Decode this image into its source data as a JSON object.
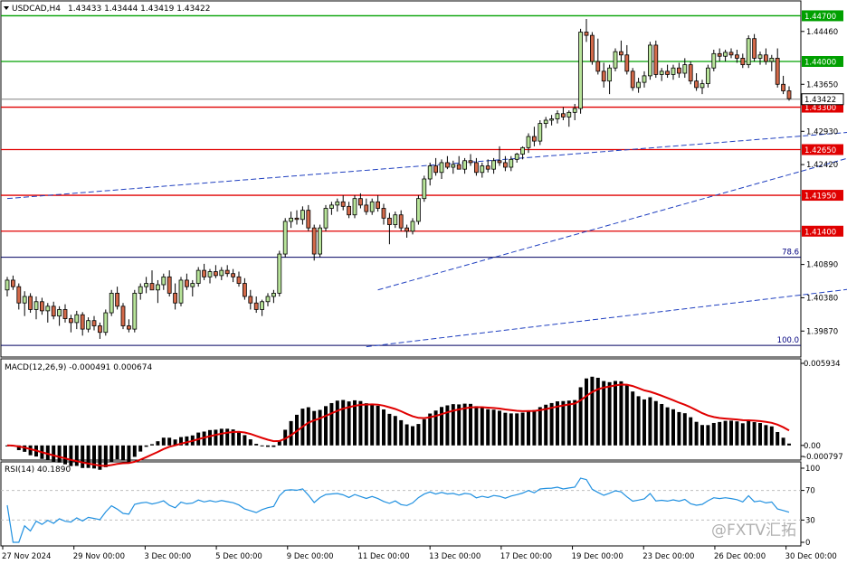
{
  "chart_data": {
    "type": "candlestick",
    "header": {
      "symbol": "USDCAD,H4",
      "ohlc": "1.43433 1.43444 1.43419 1.43422"
    },
    "price_axis": {
      "min": 1.395,
      "max": 1.449,
      "ticks": [
        "1.44460",
        "1.43650",
        "1.42930",
        "1.42420",
        "1.40890",
        "1.40380",
        "1.39870"
      ],
      "current_price": "1.43422",
      "current_value": 1.43422
    },
    "x_axis": {
      "labels": [
        "27 Nov 2024",
        "29 Nov 00:00",
        "3 Dec 00:00",
        "5 Dec 00:00",
        "9 Dec 00:00",
        "11 Dec 00:00",
        "13 Dec 00:00",
        "17 Dec 00:00",
        "19 Dec 00:00",
        "23 Dec 00:00",
        "26 Dec 00:00",
        "30 Dec 00:00"
      ]
    },
    "levels": [
      {
        "label": "1.44700",
        "value": 1.447,
        "color": "#00a000"
      },
      {
        "label": "1.44000",
        "value": 1.44,
        "color": "#00a000"
      },
      {
        "label": "1.43300",
        "value": 1.433,
        "color": "#e00000"
      },
      {
        "label": "1.42650",
        "value": 1.4265,
        "color": "#e00000"
      },
      {
        "label": "1.41950",
        "value": 1.4195,
        "color": "#e00000"
      },
      {
        "label": "1.41400",
        "value": 1.414,
        "color": "#e00000"
      }
    ],
    "fib_levels": [
      {
        "label": "78.6",
        "value": 1.41
      },
      {
        "label": "100.0",
        "value": 1.3965
      }
    ],
    "trendlines": [
      {
        "from": [
          0,
          1.419
        ],
        "to": [
          222,
          1.4345
        ]
      },
      {
        "from": [
          62,
          1.3963
        ],
        "to": [
          222,
          1.4132
        ]
      },
      {
        "from": [
          64,
          1.405
        ],
        "to": [
          222,
          1.4443
        ]
      }
    ],
    "candles": [
      [
        1.405,
        1.407,
        1.404,
        1.4065
      ],
      [
        1.4065,
        1.4072,
        1.405,
        1.4055
      ],
      [
        1.4055,
        1.406,
        1.402,
        1.403
      ],
      [
        1.403,
        1.4048,
        1.401,
        1.404
      ],
      [
        1.404,
        1.4045,
        1.4015,
        1.402
      ],
      [
        1.402,
        1.404,
        1.4005,
        1.4032
      ],
      [
        1.4032,
        1.4038,
        1.4012,
        1.4018
      ],
      [
        1.4018,
        1.403,
        1.4,
        1.4025
      ],
      [
        1.4025,
        1.4032,
        1.4005,
        1.401
      ],
      [
        1.401,
        1.4025,
        1.3995,
        1.402
      ],
      [
        1.402,
        1.4028,
        1.4,
        1.4006
      ],
      [
        1.4006,
        1.4012,
        1.3985,
        1.4
      ],
      [
        1.4,
        1.4018,
        1.399,
        1.4012
      ],
      [
        1.4012,
        1.4016,
        1.398,
        1.399
      ],
      [
        1.399,
        1.4008,
        1.3985,
        1.4003
      ],
      [
        1.4003,
        1.401,
        1.3988,
        1.3995
      ],
      [
        1.3995,
        1.4,
        1.3975,
        1.3985
      ],
      [
        1.3985,
        1.402,
        1.398,
        1.4015
      ],
      [
        1.4015,
        1.405,
        1.401,
        1.4045
      ],
      [
        1.4045,
        1.4055,
        1.402,
        1.4025
      ],
      [
        1.4025,
        1.403,
        1.399,
        1.3995
      ],
      [
        1.3995,
        1.4005,
        1.3985,
        1.399
      ],
      [
        1.399,
        1.405,
        1.3985,
        1.4045
      ],
      [
        1.4045,
        1.406,
        1.4035,
        1.4055
      ],
      [
        1.4055,
        1.407,
        1.4045,
        1.406
      ],
      [
        1.406,
        1.408,
        1.405,
        1.405
      ],
      [
        1.405,
        1.4065,
        1.403,
        1.4058
      ],
      [
        1.4058,
        1.4075,
        1.405,
        1.407
      ],
      [
        1.407,
        1.408,
        1.404,
        1.4045
      ],
      [
        1.4045,
        1.406,
        1.402,
        1.403
      ],
      [
        1.403,
        1.407,
        1.4025,
        1.4065
      ],
      [
        1.4065,
        1.4075,
        1.405,
        1.4055
      ],
      [
        1.4055,
        1.4065,
        1.404,
        1.406
      ],
      [
        1.406,
        1.4085,
        1.4055,
        1.408
      ],
      [
        1.408,
        1.409,
        1.4065,
        1.407
      ],
      [
        1.407,
        1.4082,
        1.406,
        1.4078
      ],
      [
        1.4078,
        1.4088,
        1.4068,
        1.4072
      ],
      [
        1.4072,
        1.4085,
        1.4065,
        1.408
      ],
      [
        1.408,
        1.4088,
        1.407,
        1.4075
      ],
      [
        1.4075,
        1.4082,
        1.4062,
        1.407
      ],
      [
        1.407,
        1.4078,
        1.4055,
        1.406
      ],
      [
        1.406,
        1.4068,
        1.4035,
        1.404
      ],
      [
        1.404,
        1.405,
        1.402,
        1.403
      ],
      [
        1.403,
        1.404,
        1.4015,
        1.402
      ],
      [
        1.402,
        1.4035,
        1.401,
        1.4032
      ],
      [
        1.4032,
        1.4045,
        1.4025,
        1.404
      ],
      [
        1.404,
        1.405,
        1.403,
        1.4045
      ],
      [
        1.4045,
        1.411,
        1.404,
        1.4105
      ],
      [
        1.4105,
        1.416,
        1.41,
        1.4155
      ],
      [
        1.4155,
        1.417,
        1.4145,
        1.416
      ],
      [
        1.416,
        1.4172,
        1.415,
        1.4158
      ],
      [
        1.4158,
        1.4178,
        1.415,
        1.4172
      ],
      [
        1.4172,
        1.418,
        1.414,
        1.4145
      ],
      [
        1.4145,
        1.415,
        1.4095,
        1.4105
      ],
      [
        1.4105,
        1.415,
        1.41,
        1.4145
      ],
      [
        1.4145,
        1.418,
        1.414,
        1.4175
      ],
      [
        1.4175,
        1.4185,
        1.4165,
        1.418
      ],
      [
        1.418,
        1.419,
        1.417,
        1.4185
      ],
      [
        1.4185,
        1.4195,
        1.4172,
        1.4178
      ],
      [
        1.4178,
        1.4185,
        1.416,
        1.4165
      ],
      [
        1.4165,
        1.4195,
        1.416,
        1.419
      ],
      [
        1.419,
        1.4198,
        1.4175,
        1.418
      ],
      [
        1.418,
        1.419,
        1.4165,
        1.417
      ],
      [
        1.417,
        1.419,
        1.4165,
        1.4185
      ],
      [
        1.4185,
        1.4195,
        1.417,
        1.4175
      ],
      [
        1.4175,
        1.4182,
        1.415,
        1.416
      ],
      [
        1.416,
        1.4168,
        1.412,
        1.415
      ],
      [
        1.415,
        1.417,
        1.4145,
        1.4165
      ],
      [
        1.4165,
        1.4172,
        1.414,
        1.4145
      ],
      [
        1.4145,
        1.415,
        1.413,
        1.414
      ],
      [
        1.414,
        1.416,
        1.4135,
        1.4155
      ],
      [
        1.4155,
        1.4195,
        1.415,
        1.419
      ],
      [
        1.419,
        1.4225,
        1.4185,
        1.422
      ],
      [
        1.422,
        1.4245,
        1.421,
        1.424
      ],
      [
        1.424,
        1.4252,
        1.4225,
        1.423
      ],
      [
        1.423,
        1.425,
        1.422,
        1.4245
      ],
      [
        1.4245,
        1.4255,
        1.4235,
        1.4238
      ],
      [
        1.4238,
        1.4248,
        1.4228,
        1.4242
      ],
      [
        1.4242,
        1.4255,
        1.4235,
        1.4235
      ],
      [
        1.4235,
        1.4252,
        1.4228,
        1.4248
      ],
      [
        1.4248,
        1.4258,
        1.424,
        1.4245
      ],
      [
        1.4245,
        1.4252,
        1.4225,
        1.423
      ],
      [
        1.423,
        1.4245,
        1.4222,
        1.424
      ],
      [
        1.424,
        1.425,
        1.423,
        1.4235
      ],
      [
        1.4235,
        1.4252,
        1.4228,
        1.4248
      ],
      [
        1.4248,
        1.427,
        1.424,
        1.4245
      ],
      [
        1.4245,
        1.4255,
        1.4232,
        1.4238
      ],
      [
        1.4238,
        1.4255,
        1.4232,
        1.425
      ],
      [
        1.425,
        1.426,
        1.4245,
        1.4258
      ],
      [
        1.4258,
        1.427,
        1.425,
        1.4268
      ],
      [
        1.4268,
        1.429,
        1.426,
        1.4285
      ],
      [
        1.4285,
        1.43,
        1.427,
        1.4278
      ],
      [
        1.4278,
        1.431,
        1.4272,
        1.4305
      ],
      [
        1.4305,
        1.4315,
        1.4298,
        1.431
      ],
      [
        1.431,
        1.4318,
        1.4302,
        1.4312
      ],
      [
        1.4312,
        1.4325,
        1.4305,
        1.432
      ],
      [
        1.432,
        1.433,
        1.431,
        1.4315
      ],
      [
        1.4315,
        1.4325,
        1.43,
        1.4322
      ],
      [
        1.4322,
        1.4335,
        1.431,
        1.4328
      ],
      [
        1.4328,
        1.445,
        1.432,
        1.4445
      ],
      [
        1.4445,
        1.4465,
        1.443,
        1.444
      ],
      [
        1.444,
        1.4445,
        1.4395,
        1.44
      ],
      [
        1.44,
        1.4435,
        1.438,
        1.4385
      ],
      [
        1.4385,
        1.4398,
        1.436,
        1.437
      ],
      [
        1.437,
        1.4395,
        1.435,
        1.439
      ],
      [
        1.439,
        1.442,
        1.4385,
        1.4415
      ],
      [
        1.4415,
        1.4432,
        1.44,
        1.441
      ],
      [
        1.441,
        1.4425,
        1.438,
        1.4385
      ],
      [
        1.4385,
        1.439,
        1.4355,
        1.436
      ],
      [
        1.436,
        1.4375,
        1.4352,
        1.4368
      ],
      [
        1.4368,
        1.4385,
        1.436,
        1.4378
      ],
      [
        1.4378,
        1.443,
        1.4372,
        1.4425
      ],
      [
        1.4425,
        1.4432,
        1.4375,
        1.438
      ],
      [
        1.438,
        1.439,
        1.437,
        1.4385
      ],
      [
        1.4385,
        1.4395,
        1.4375,
        1.438
      ],
      [
        1.438,
        1.4395,
        1.4372,
        1.439
      ],
      [
        1.439,
        1.4398,
        1.4375,
        1.4382
      ],
      [
        1.4382,
        1.4405,
        1.4375,
        1.4395
      ],
      [
        1.4395,
        1.44,
        1.4365,
        1.437
      ],
      [
        1.437,
        1.4382,
        1.4355,
        1.436
      ],
      [
        1.436,
        1.4372,
        1.435,
        1.4366
      ],
      [
        1.4366,
        1.4395,
        1.436,
        1.439
      ],
      [
        1.439,
        1.4418,
        1.4385,
        1.4412
      ],
      [
        1.4412,
        1.442,
        1.44,
        1.4408
      ],
      [
        1.4408,
        1.4418,
        1.44,
        1.4414
      ],
      [
        1.4414,
        1.442,
        1.4405,
        1.441
      ],
      [
        1.441,
        1.4418,
        1.4398,
        1.4405
      ],
      [
        1.4405,
        1.4412,
        1.439,
        1.4395
      ],
      [
        1.4395,
        1.444,
        1.439,
        1.4435
      ],
      [
        1.4435,
        1.4442,
        1.44,
        1.4405
      ],
      [
        1.4405,
        1.4415,
        1.4395,
        1.441
      ],
      [
        1.441,
        1.442,
        1.4395,
        1.44
      ],
      [
        1.44,
        1.441,
        1.4385,
        1.4405
      ],
      [
        1.4405,
        1.442,
        1.436,
        1.4365
      ],
      [
        1.4365,
        1.4378,
        1.435,
        1.4355
      ],
      [
        1.4355,
        1.4362,
        1.434,
        1.4343
      ]
    ],
    "macd": {
      "label": "MACD(12,26,9) -0.000491 0.000674",
      "ticks": [
        "0.005934",
        "0.00",
        "-0.000797"
      ],
      "max": 0.005934,
      "min": -0.000797
    },
    "rsi": {
      "label": "RSI(14) 40.1890",
      "ticks": [
        "100",
        "70",
        "30",
        "0"
      ]
    },
    "watermark": "@FXTV汇拓"
  }
}
